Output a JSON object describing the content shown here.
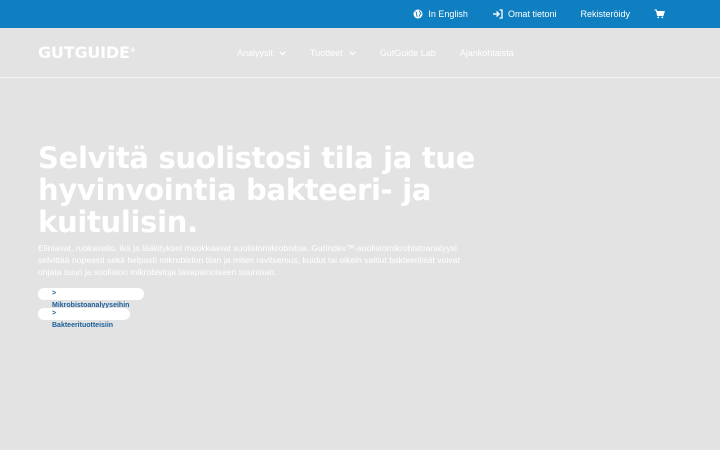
{
  "topbar": {
    "language": "In English",
    "account": "Omat tietoni",
    "register": "Rekisteröidy",
    "cart_icon": "cart-icon",
    "background": "#0f7fc1"
  },
  "logo": {
    "text": "GUTGUIDE",
    "mark": "®"
  },
  "nav": {
    "items": [
      {
        "label": "Analyysit",
        "has_dropdown": true
      },
      {
        "label": "Tuotteet",
        "has_dropdown": true
      },
      {
        "label": "GutGuide Lab",
        "has_dropdown": false
      },
      {
        "label": "Ajankohtaista",
        "has_dropdown": false
      }
    ]
  },
  "hero": {
    "title": "Selvitä suolistosi tila ja tue hyvinvointia bakteeri- ja kuitulisin.",
    "text": "Elintavat, ruokavalio, ikä ja lääkitykset muokkaavat suolistomikrobistoa. GutIndex™-suolistomikrobistoanalyysi selvittää nopeasti sekä helposti mikrobiston tilan ja miten ravitsemus, kuidut tai oikein valitut bakteerilisät voivat ohjata suun ja suoliston mikrobistoja tasapainoiseen suuntaan.",
    "cta_primary": "> Mikrobistoanalyyseihin",
    "cta_secondary": "> Bakteerituotteisiin"
  },
  "colors": {
    "page_background": "#e3e3e3",
    "button_text": "#1a5e9a"
  }
}
